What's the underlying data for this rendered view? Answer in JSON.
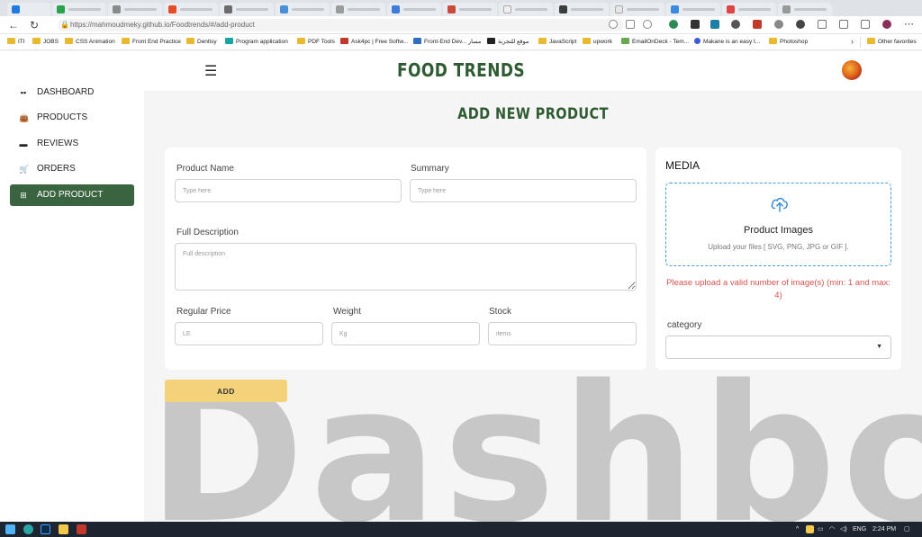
{
  "browser": {
    "url_host": "https://mahmoudmeky.github.io",
    "url_path": "/Foodtrends/#/add-product",
    "bookmarks": [
      "ITI",
      "JOBS",
      "CSS Animation",
      "Front End Practice",
      "Dentisy",
      "Program application",
      "PDF Tools",
      "Ask4pc | Free Softw...",
      "Front-End Dev... مسار",
      "موقع للتجربة",
      "JavaScript",
      "upwork",
      "EmailOnDeck - Tem...",
      "Makane is an easy t...",
      "Photoshop"
    ],
    "other_favorites": "Other favorites"
  },
  "header": {
    "brand": "FOOD TRENDS",
    "menu_icon": "☰"
  },
  "sidebar": {
    "items": [
      {
        "label": "DASHBOARD",
        "icon": "▪▪"
      },
      {
        "label": "PRODUCTS",
        "icon": "👜"
      },
      {
        "label": "REVIEWS",
        "icon": "▬"
      },
      {
        "label": "ORDERS",
        "icon": "🛒"
      },
      {
        "label": "ADD PRODUCT",
        "icon": "⊞"
      }
    ]
  },
  "page": {
    "title": "ADD NEW PRODUCT",
    "form": {
      "product_name_label": "Product Name",
      "product_name_placeholder": "Type here",
      "summary_label": "Summary",
      "summary_placeholder": "Type here",
      "full_description_label": "Full Description",
      "full_description_placeholder": "Full description",
      "regular_price_label": "Regular Price",
      "regular_price_placeholder": "LE",
      "weight_label": "Weight",
      "weight_placeholder": "Kg",
      "stock_label": "Stock",
      "stock_placeholder": "items"
    },
    "media": {
      "title": "MEDIA",
      "dropzone_title": "Product Images",
      "dropzone_subtitle": "Upload your files [ SVG, PNG, JPG or GIF ].",
      "error": "Please upload a valid number of image(s) (min: 1 and max: 4)",
      "category_label": "category",
      "category_value": ""
    },
    "add_button": "ADD",
    "watermark": "Dashboard"
  },
  "taskbar": {
    "lang": "ENG",
    "time": "2:24 PM"
  },
  "colors": {
    "brand_green": "#2f5b33",
    "active_item": "#3a6440",
    "add_button": "#f3d27a",
    "error": "#d9534f",
    "dropzone_border": "#4b9bd6"
  }
}
